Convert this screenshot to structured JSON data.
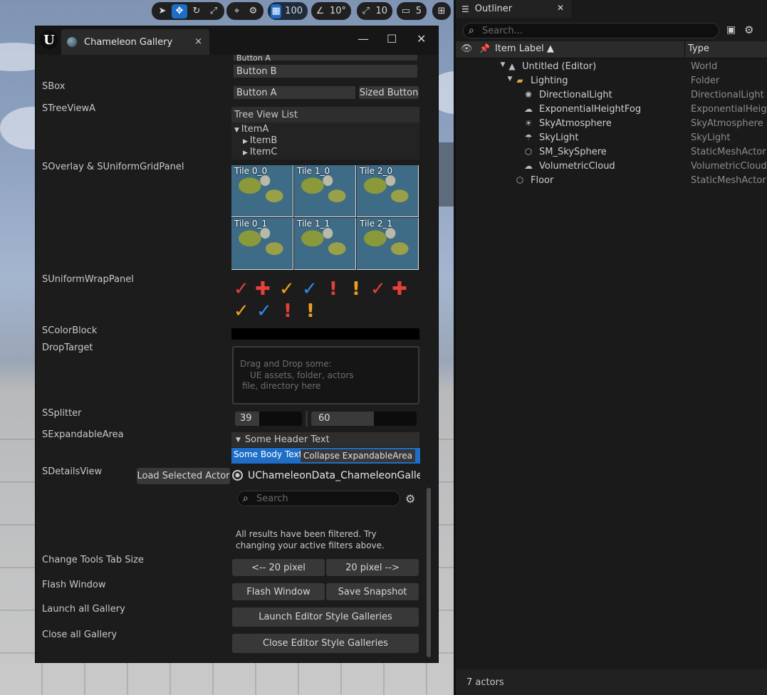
{
  "toolbar": {
    "grid_value": "100",
    "angle_value": "10°",
    "scale_value": "10",
    "camera_value": "5"
  },
  "window": {
    "tab_title": "Chameleon Gallery",
    "tab_close": "×",
    "minimize": "—",
    "maximize": "☐",
    "close": "✕"
  },
  "gallery": {
    "btn_top_partial": "Button A",
    "btn_b": "Button B",
    "sbox_label": "SBox",
    "sbox_btn_a": "Button A",
    "sbox_sized": "Sized Button",
    "tree_label": "STreeViewA",
    "tree_header": "Tree View List",
    "tree_items": [
      "ItemA",
      "ItemB",
      "ItemC"
    ],
    "overlay_label": "SOverlay & SUniformGridPanel",
    "tiles": [
      "Tile 0_0",
      "Tile 1_0",
      "Tile 2_0",
      "Tile 0_1",
      "Tile 1_1",
      "Tile 2_1"
    ],
    "wrap_label": "SUniformWrapPanel",
    "colorblock_label": "SColorBlock",
    "drop_label": "DropTarget",
    "drop_text": [
      "Drag and Drop some:",
      "UE assets, folder, actors",
      "file, directory here"
    ],
    "splitter_label": "SSplitter",
    "splitter_left": "39",
    "splitter_right": "60",
    "expand_label": "SExpandableArea",
    "expand_header": "Some Header Text",
    "expand_body": "Some Body Text",
    "expand_collapse": "Collapse ExpandableArea",
    "details_label": "SDetailsView",
    "load_actor": "Load Selected Actor",
    "details_object": "UChameleonData_ChameleonGaller",
    "details_search": "Search",
    "details_filtered": "All results have been filtered. Try changing your active filters above.",
    "tabsize_label": "Change Tools Tab Size",
    "tabsize_left": "<-- 20 pixel",
    "tabsize_right": "20 pixel -->",
    "flash_label": "Flash Window",
    "flash_btn": "Flash Window",
    "snapshot_btn": "Save Snapshot",
    "launch_label": "Launch all Gallery",
    "launch_btn": "Launch Editor Style Galleries",
    "close_label": "Close all Gallery",
    "close_btn": "Close Editor Style Galleries"
  },
  "outliner": {
    "tab": "Outliner",
    "tab_close": "✕",
    "search_placeholder": "Search...",
    "col_label": "Item Label ▲",
    "col_type": "Type",
    "rows": [
      {
        "name": "Untitled (Editor)",
        "type": "World"
      },
      {
        "name": "Lighting",
        "type": "Folder"
      },
      {
        "name": "DirectionalLight",
        "type": "DirectionalLight"
      },
      {
        "name": "ExponentialHeightFog",
        "type": "ExponentialHeightFog"
      },
      {
        "name": "SkyAtmosphere",
        "type": "SkyAtmosphere"
      },
      {
        "name": "SkyLight",
        "type": "SkyLight"
      },
      {
        "name": "SM_SkySphere",
        "type": "StaticMeshActor"
      },
      {
        "name": "VolumetricCloud",
        "type": "VolumetricCloud"
      },
      {
        "name": "Floor",
        "type": "StaticMeshActor"
      }
    ],
    "status": "7 actors"
  },
  "colors": {
    "accent": "#1e6ec8",
    "red": "#e5403a",
    "orange": "#f0a11e",
    "blue": "#2e8ae6"
  }
}
